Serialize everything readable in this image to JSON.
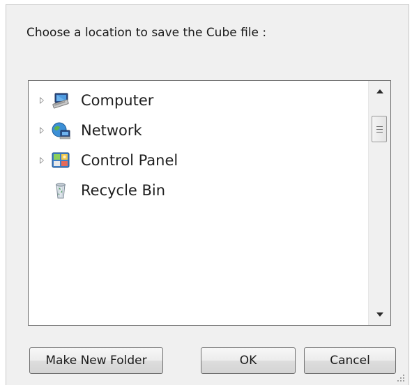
{
  "dialog": {
    "prompt": "Choose a location to save the Cube file :"
  },
  "tree": {
    "items": [
      {
        "label": "Computer",
        "icon": "computer-icon",
        "expandable": true
      },
      {
        "label": "Network",
        "icon": "network-icon",
        "expandable": true
      },
      {
        "label": "Control Panel",
        "icon": "control-panel-icon",
        "expandable": true
      },
      {
        "label": "Recycle Bin",
        "icon": "recycle-bin-icon",
        "expandable": false
      }
    ]
  },
  "buttons": {
    "make_new_folder": "Make New Folder",
    "ok": "OK",
    "cancel": "Cancel"
  },
  "colors": {
    "dialog_background": "#f0f0f0",
    "tree_background": "#ffffff",
    "tree_border": "#6d6d6d"
  }
}
